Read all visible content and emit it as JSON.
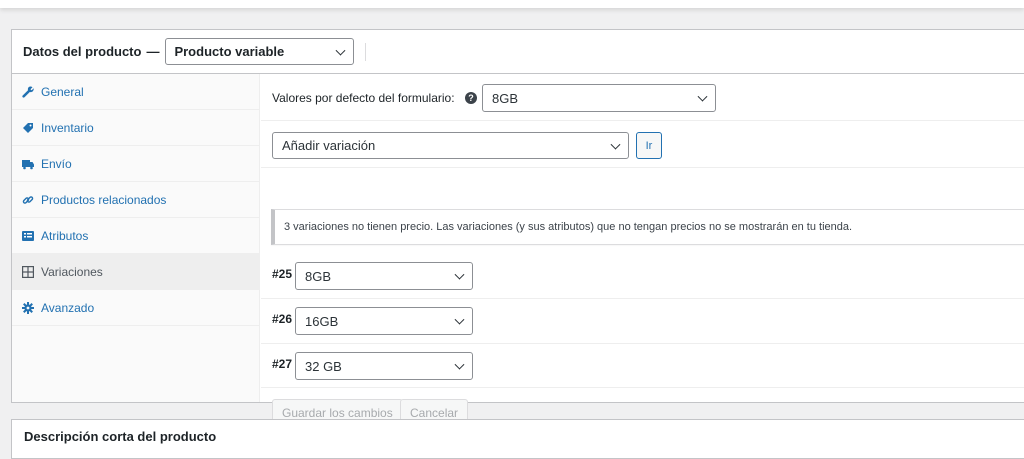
{
  "header": {
    "title": "Datos del producto",
    "dash": "—",
    "product_type": "Producto variable"
  },
  "tabs": [
    {
      "label": "General",
      "icon": "wrench-icon"
    },
    {
      "label": "Inventario",
      "icon": "tag-icon"
    },
    {
      "label": "Envío",
      "icon": "truck-icon"
    },
    {
      "label": "Productos relacionados",
      "icon": "link-icon"
    },
    {
      "label": "Atributos",
      "icon": "list-icon"
    },
    {
      "label": "Variaciones",
      "icon": "grid-icon",
      "active": true
    },
    {
      "label": "Avanzado",
      "icon": "gear-icon"
    }
  ],
  "defaults": {
    "label": "Valores por defecto del formulario:",
    "help": "?",
    "value": "8GB"
  },
  "add_variation": {
    "value": "Añadir variación",
    "go_label": "Ir"
  },
  "notice": "3 variaciones no tienen precio. Las variaciones (y sus atributos) que no tengan precios no se mostrarán en tu tienda.",
  "variations": [
    {
      "id": "#25",
      "value": "8GB"
    },
    {
      "id": "#26",
      "value": "16GB"
    },
    {
      "id": "#27",
      "value": "32 GB"
    }
  ],
  "actions": {
    "save": "Guardar los cambios",
    "cancel": "Cancelar"
  },
  "bottom_panel": {
    "title": "Descripción corta del producto"
  },
  "colors": {
    "link": "#2271b1",
    "border": "#c3c4c7",
    "active_tab_bg": "#eeeeee"
  }
}
